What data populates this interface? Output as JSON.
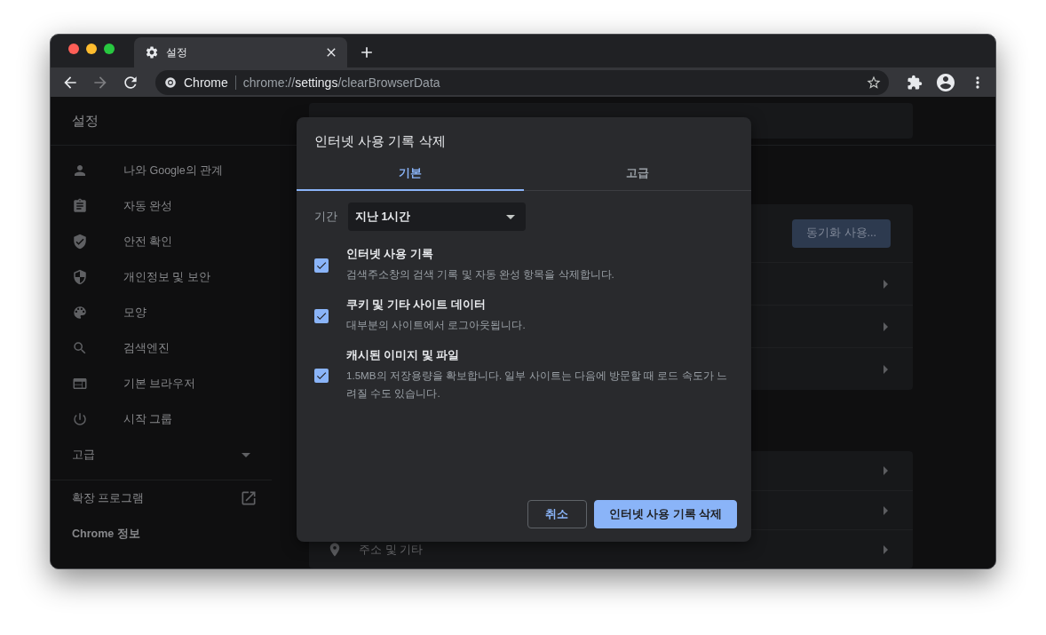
{
  "tabs": [
    {
      "title": "설정",
      "selected": true
    }
  ],
  "toolbar": {
    "forward": {
      "disabled": true
    },
    "site_label": "Chrome",
    "url": {
      "scheme": "chrome://",
      "host": "settings",
      "path": "/clearBrowserData"
    }
  },
  "sidebar": {
    "title": "설정",
    "items": [
      {
        "label": "나와 Google의 관계"
      },
      {
        "label": "자동 완성"
      },
      {
        "label": "안전 확인"
      },
      {
        "label": "개인정보 및 보안"
      },
      {
        "label": "모양"
      },
      {
        "label": "검색엔진"
      },
      {
        "label": "기본 브라우저"
      },
      {
        "label": "시작 그룹"
      }
    ],
    "advanced": {
      "label": "고급",
      "expanded": false
    },
    "extensions": "확장 프로그램",
    "about": "Chrome 정보"
  },
  "main": {
    "sync_button": "동기화 사용...",
    "address_row": "주소 및 기타"
  },
  "dialog": {
    "title": "인터넷 사용 기록 삭제",
    "tabs": [
      {
        "label": "기본",
        "selected": true
      },
      {
        "label": "고급",
        "selected": false
      }
    ],
    "time_range": {
      "label": "기간",
      "value": "지난 1시간"
    },
    "options": [
      {
        "title": "인터넷 사용 기록",
        "description": "검색주소창의 검색 기록 및 자동 완성 항목을 삭제합니다.",
        "checked": true
      },
      {
        "title": "쿠키 및 기타 사이트 데이터",
        "description": "대부분의 사이트에서 로그아웃됩니다.",
        "checked": true
      },
      {
        "title": "캐시된 이미지 및 파일",
        "description": "1.5MB의 저장용량을 확보합니다. 일부 사이트는 다음에 방문할 때 로드 속도가 느려질 수도 있습니다.",
        "checked": true
      }
    ],
    "buttons": [
      {
        "label": "취소",
        "kind": "secondary"
      },
      {
        "label": "인터넷 사용 기록 삭제",
        "kind": "primary"
      }
    ]
  }
}
